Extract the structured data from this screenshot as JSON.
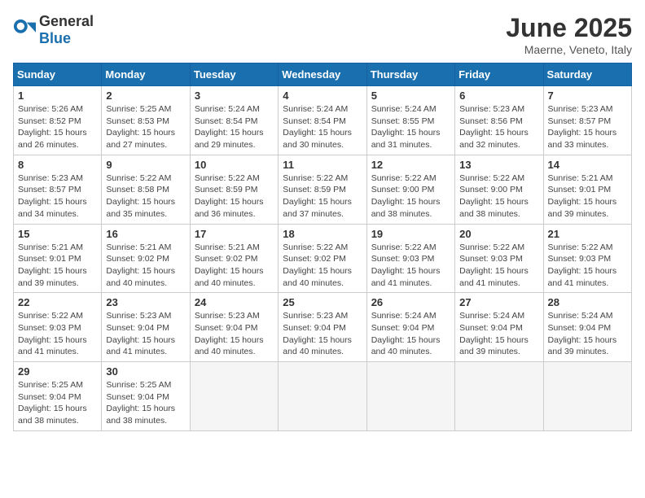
{
  "logo": {
    "general": "General",
    "blue": "Blue"
  },
  "title": "June 2025",
  "subtitle": "Maerne, Veneto, Italy",
  "headers": [
    "Sunday",
    "Monday",
    "Tuesday",
    "Wednesday",
    "Thursday",
    "Friday",
    "Saturday"
  ],
  "weeks": [
    [
      {
        "day": "1",
        "info": "Sunrise: 5:26 AM\nSunset: 8:52 PM\nDaylight: 15 hours\nand 26 minutes."
      },
      {
        "day": "2",
        "info": "Sunrise: 5:25 AM\nSunset: 8:53 PM\nDaylight: 15 hours\nand 27 minutes."
      },
      {
        "day": "3",
        "info": "Sunrise: 5:24 AM\nSunset: 8:54 PM\nDaylight: 15 hours\nand 29 minutes."
      },
      {
        "day": "4",
        "info": "Sunrise: 5:24 AM\nSunset: 8:54 PM\nDaylight: 15 hours\nand 30 minutes."
      },
      {
        "day": "5",
        "info": "Sunrise: 5:24 AM\nSunset: 8:55 PM\nDaylight: 15 hours\nand 31 minutes."
      },
      {
        "day": "6",
        "info": "Sunrise: 5:23 AM\nSunset: 8:56 PM\nDaylight: 15 hours\nand 32 minutes."
      },
      {
        "day": "7",
        "info": "Sunrise: 5:23 AM\nSunset: 8:57 PM\nDaylight: 15 hours\nand 33 minutes."
      }
    ],
    [
      {
        "day": "8",
        "info": "Sunrise: 5:23 AM\nSunset: 8:57 PM\nDaylight: 15 hours\nand 34 minutes."
      },
      {
        "day": "9",
        "info": "Sunrise: 5:22 AM\nSunset: 8:58 PM\nDaylight: 15 hours\nand 35 minutes."
      },
      {
        "day": "10",
        "info": "Sunrise: 5:22 AM\nSunset: 8:59 PM\nDaylight: 15 hours\nand 36 minutes."
      },
      {
        "day": "11",
        "info": "Sunrise: 5:22 AM\nSunset: 8:59 PM\nDaylight: 15 hours\nand 37 minutes."
      },
      {
        "day": "12",
        "info": "Sunrise: 5:22 AM\nSunset: 9:00 PM\nDaylight: 15 hours\nand 38 minutes."
      },
      {
        "day": "13",
        "info": "Sunrise: 5:22 AM\nSunset: 9:00 PM\nDaylight: 15 hours\nand 38 minutes."
      },
      {
        "day": "14",
        "info": "Sunrise: 5:21 AM\nSunset: 9:01 PM\nDaylight: 15 hours\nand 39 minutes."
      }
    ],
    [
      {
        "day": "15",
        "info": "Sunrise: 5:21 AM\nSunset: 9:01 PM\nDaylight: 15 hours\nand 39 minutes."
      },
      {
        "day": "16",
        "info": "Sunrise: 5:21 AM\nSunset: 9:02 PM\nDaylight: 15 hours\nand 40 minutes."
      },
      {
        "day": "17",
        "info": "Sunrise: 5:21 AM\nSunset: 9:02 PM\nDaylight: 15 hours\nand 40 minutes."
      },
      {
        "day": "18",
        "info": "Sunrise: 5:22 AM\nSunset: 9:02 PM\nDaylight: 15 hours\nand 40 minutes."
      },
      {
        "day": "19",
        "info": "Sunrise: 5:22 AM\nSunset: 9:03 PM\nDaylight: 15 hours\nand 41 minutes."
      },
      {
        "day": "20",
        "info": "Sunrise: 5:22 AM\nSunset: 9:03 PM\nDaylight: 15 hours\nand 41 minutes."
      },
      {
        "day": "21",
        "info": "Sunrise: 5:22 AM\nSunset: 9:03 PM\nDaylight: 15 hours\nand 41 minutes."
      }
    ],
    [
      {
        "day": "22",
        "info": "Sunrise: 5:22 AM\nSunset: 9:03 PM\nDaylight: 15 hours\nand 41 minutes."
      },
      {
        "day": "23",
        "info": "Sunrise: 5:23 AM\nSunset: 9:04 PM\nDaylight: 15 hours\nand 41 minutes."
      },
      {
        "day": "24",
        "info": "Sunrise: 5:23 AM\nSunset: 9:04 PM\nDaylight: 15 hours\nand 40 minutes."
      },
      {
        "day": "25",
        "info": "Sunrise: 5:23 AM\nSunset: 9:04 PM\nDaylight: 15 hours\nand 40 minutes."
      },
      {
        "day": "26",
        "info": "Sunrise: 5:24 AM\nSunset: 9:04 PM\nDaylight: 15 hours\nand 40 minutes."
      },
      {
        "day": "27",
        "info": "Sunrise: 5:24 AM\nSunset: 9:04 PM\nDaylight: 15 hours\nand 39 minutes."
      },
      {
        "day": "28",
        "info": "Sunrise: 5:24 AM\nSunset: 9:04 PM\nDaylight: 15 hours\nand 39 minutes."
      }
    ],
    [
      {
        "day": "29",
        "info": "Sunrise: 5:25 AM\nSunset: 9:04 PM\nDaylight: 15 hours\nand 38 minutes."
      },
      {
        "day": "30",
        "info": "Sunrise: 5:25 AM\nSunset: 9:04 PM\nDaylight: 15 hours\nand 38 minutes."
      },
      {
        "day": "",
        "info": ""
      },
      {
        "day": "",
        "info": ""
      },
      {
        "day": "",
        "info": ""
      },
      {
        "day": "",
        "info": ""
      },
      {
        "day": "",
        "info": ""
      }
    ]
  ]
}
